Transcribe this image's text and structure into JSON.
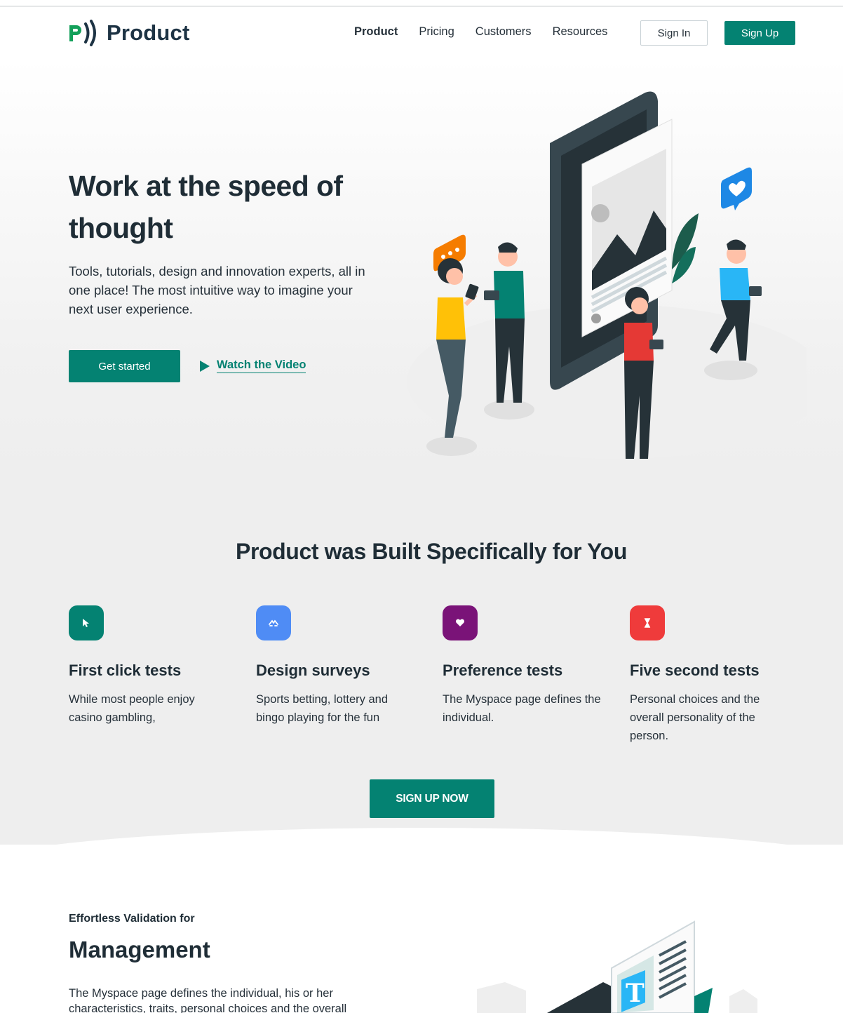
{
  "header": {
    "logo_text": "Product",
    "nav": [
      "Product",
      "Pricing",
      "Customers",
      "Resources"
    ],
    "sign_in": "Sign In",
    "sign_up": "Sign Up"
  },
  "hero": {
    "title": "Work at the speed of thought",
    "subtitle": "Tools, tutorials, design and innovation experts, all in one place! The most intuitive way to imagine your next user experience.",
    "cta_primary": "Get started",
    "cta_video": "Watch the Video"
  },
  "features": {
    "title": "Product was Built Specifically for You",
    "items": [
      {
        "title": "First click tests",
        "desc": "While most people enjoy casino gambling,",
        "color": "#048272",
        "icon": "cursor-icon"
      },
      {
        "title": "Design surveys",
        "desc": "Sports betting, lottery and bingo playing for the fun",
        "color": "#4f8cf5",
        "icon": "survey-icon"
      },
      {
        "title": "Preference tests",
        "desc": "The Myspace page defines the individual.",
        "color": "#7a1378",
        "icon": "heart-icon"
      },
      {
        "title": "Five second tests",
        "desc": "Personal choices and the overall personality of the person.",
        "color": "#ef3b3b",
        "icon": "hourglass-icon"
      }
    ],
    "cta": "SIGN UP NOW"
  },
  "bottom": {
    "kicker": "Effortless Validation for",
    "title": "Management",
    "desc": "The Myspace page defines the individual, his or her characteristics, traits, personal choices and the overall"
  },
  "colors": {
    "primary": "#048272",
    "text": "#1f2d36"
  }
}
